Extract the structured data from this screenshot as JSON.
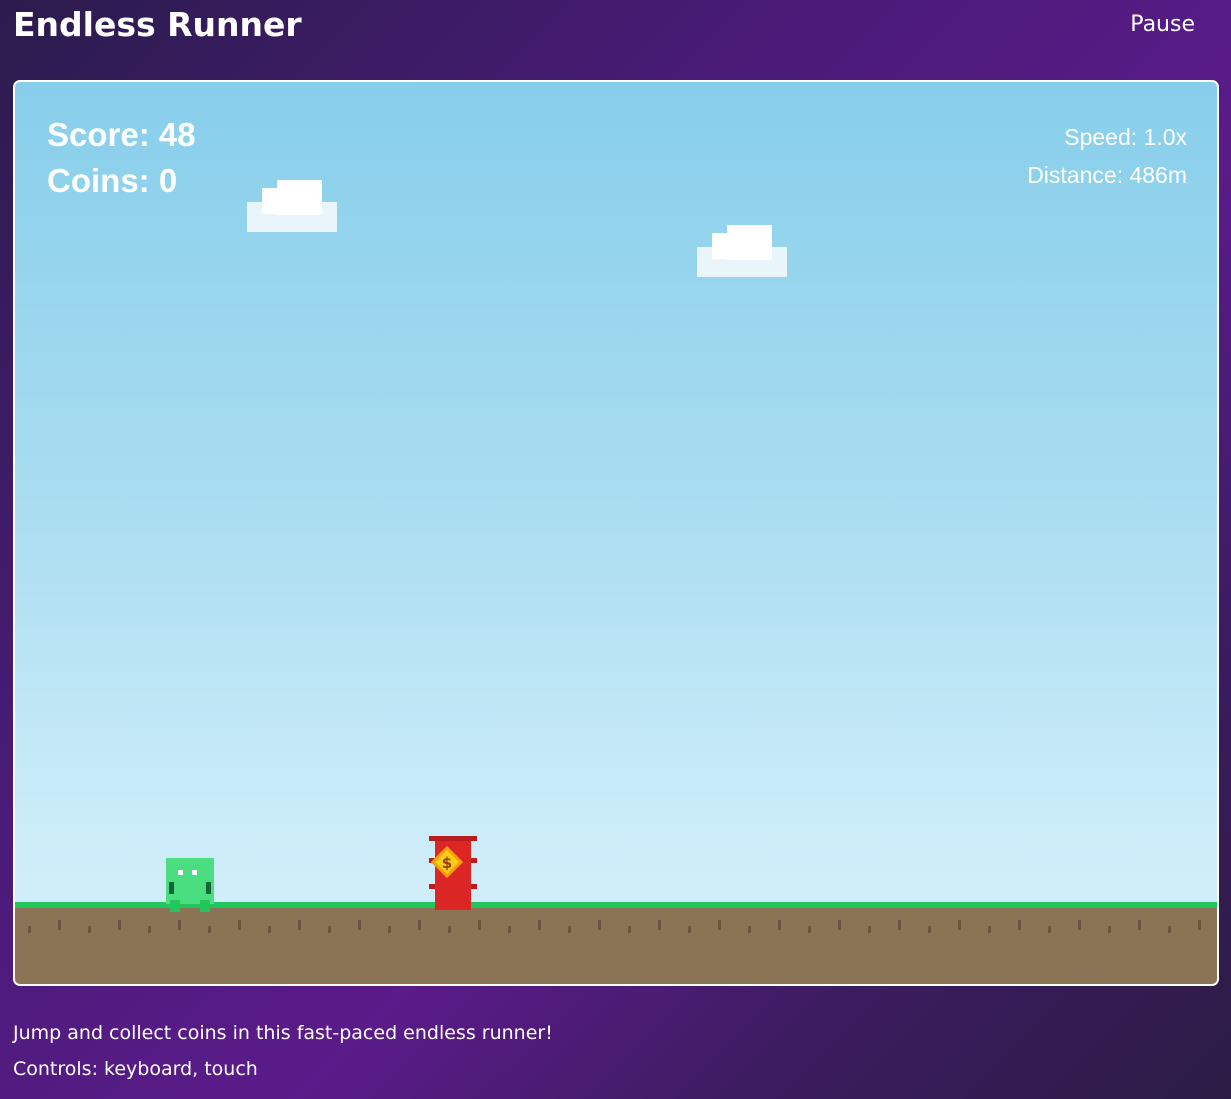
{
  "app": {
    "title": "Endless Runner",
    "pause_label": "Pause"
  },
  "hud": {
    "score_label": "Score: 48",
    "coins_label": "Coins: 0",
    "speed_label": "Speed: 1.0x",
    "distance_label": "Distance: 486m"
  },
  "footer": {
    "description": "Jump and collect coins in this fast-paced endless runner!",
    "controls": "Controls: keyboard, touch"
  },
  "colors": {
    "sky_top": "#87ceeb",
    "grass": "#22c55e",
    "dirt": "#8b7355",
    "player": "#4ade80",
    "obstacle": "#dc2626",
    "coin": "#facc15"
  },
  "icons": {
    "obstacle_symbol": "$"
  }
}
